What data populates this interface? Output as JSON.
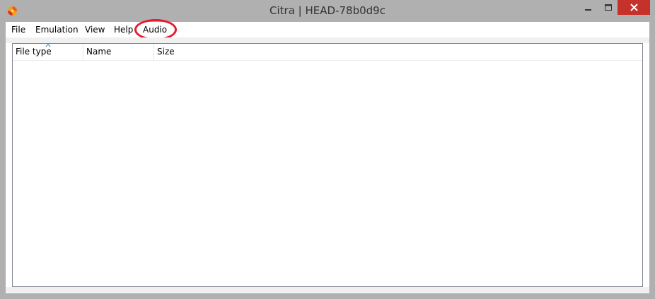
{
  "window": {
    "title": "Citra | HEAD-78b0d9c",
    "app_icon": "citra-logo-icon",
    "controls": {
      "minimize_icon": "minimize-icon",
      "maximize_icon": "maximize-icon",
      "close_icon": "close-icon"
    },
    "colors": {
      "frame": "#b0b0b0",
      "close_button": "#c7312c",
      "annotation_circle": "#e8192c"
    }
  },
  "menubar": {
    "items": [
      {
        "label": "File"
      },
      {
        "label": "Emulation"
      },
      {
        "label": "View"
      },
      {
        "label": "Help"
      },
      {
        "label": "Audio"
      }
    ]
  },
  "game_list": {
    "columns": [
      {
        "label": "File type",
        "sorted": true,
        "sort_direction": "ascending"
      },
      {
        "label": "Name"
      },
      {
        "label": "Size"
      }
    ],
    "rows": []
  }
}
